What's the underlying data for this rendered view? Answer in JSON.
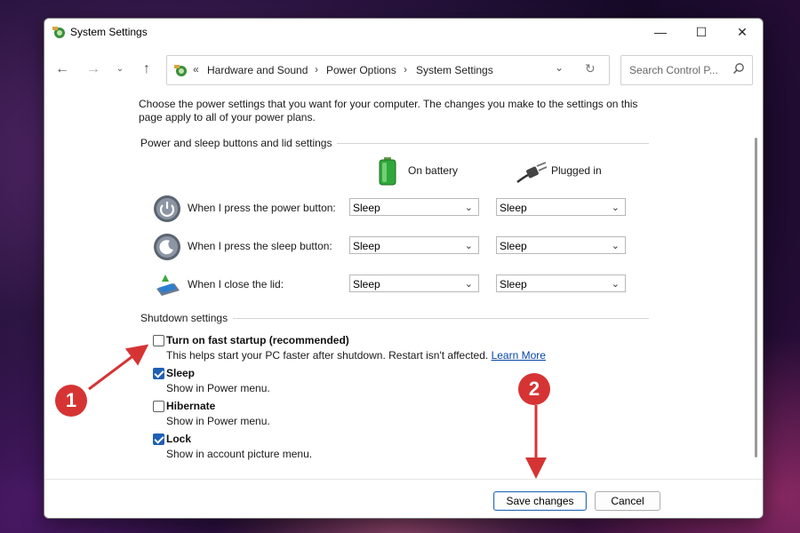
{
  "window": {
    "title": "System Settings"
  },
  "breadcrumb": {
    "overflow": "«",
    "items": [
      "Hardware and Sound",
      "Power Options",
      "System Settings"
    ],
    "separator": "›"
  },
  "search": {
    "placeholder": "Search Control P..."
  },
  "intro_text": "Choose the power settings that you want for your computer. The changes you make to the settings on this page apply to all of your power plans.",
  "power_section": {
    "title": "Power and sleep buttons and lid settings",
    "col_battery": "On battery",
    "col_plugged": "Plugged in",
    "rows": [
      {
        "label": "When I press the power button:",
        "battery": "Sleep",
        "plugged": "Sleep",
        "icon": "power-button-icon"
      },
      {
        "label": "When I press the sleep button:",
        "battery": "Sleep",
        "plugged": "Sleep",
        "icon": "sleep-button-icon"
      },
      {
        "label": "When I close the lid:",
        "battery": "Sleep",
        "plugged": "Sleep",
        "icon": "laptop-lid-icon"
      }
    ]
  },
  "shutdown_section": {
    "title": "Shutdown settings",
    "items": [
      {
        "label": "Turn on fast startup (recommended)",
        "desc": "This helps start your PC faster after shutdown. Restart isn't affected.",
        "link": "Learn More",
        "checked": false
      },
      {
        "label": "Sleep",
        "desc": "Show in Power menu.",
        "checked": true
      },
      {
        "label": "Hibernate",
        "desc": "Show in Power menu.",
        "checked": false
      },
      {
        "label": "Lock",
        "desc": "Show in account picture menu.",
        "checked": true
      }
    ]
  },
  "footer": {
    "save_label": "Save changes",
    "cancel_label": "Cancel"
  },
  "annotations": {
    "badge_1": "1",
    "badge_2": "2"
  },
  "colors": {
    "accent": "#1f5fb4",
    "badge": "#d63434",
    "link": "#0645ad"
  }
}
